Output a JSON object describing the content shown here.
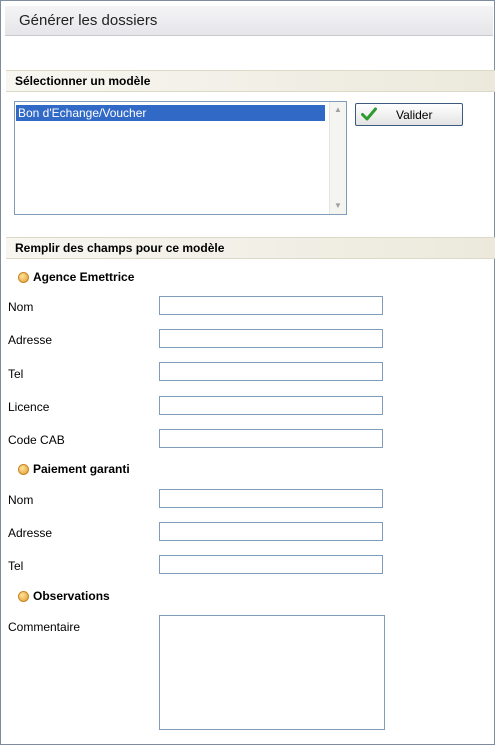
{
  "page_title": "Générer les dossiers",
  "model_section": {
    "header": "Sélectionner un modèle",
    "models": [
      "Bon d'Echange/Voucher"
    ],
    "selected_index": 0,
    "submit_label": "Valider"
  },
  "fields_section": {
    "header": "Remplir des champs pour ce modèle",
    "groups": [
      {
        "title": "Agence Emettrice",
        "fields": [
          {
            "label": "Nom",
            "value": ""
          },
          {
            "label": "Adresse",
            "value": ""
          },
          {
            "label": "Tel",
            "value": ""
          },
          {
            "label": "Licence",
            "value": ""
          },
          {
            "label": "Code CAB",
            "value": ""
          }
        ]
      },
      {
        "title": "Paiement garanti",
        "fields": [
          {
            "label": "Nom",
            "value": ""
          },
          {
            "label": "Adresse",
            "value": ""
          },
          {
            "label": "Tel",
            "value": ""
          }
        ]
      },
      {
        "title": "Observations",
        "fields": [
          {
            "label": "Commentaire",
            "value": ""
          }
        ]
      }
    ]
  }
}
